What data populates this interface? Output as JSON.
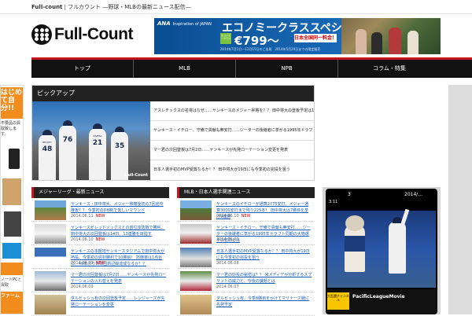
{
  "site": {
    "tagline_brand": "Full-count",
    "tagline_rest": " | フルカウント ―野球・MLBの最新ニュース配信―",
    "logo_text": "Full-Count"
  },
  "ad": {
    "ana_text": "ANA",
    "ana_sub": "Inspiration of JAPAN",
    "headline": "エコノミークラススペシャル",
    "tag_text": "エコノミークラス",
    "price": "€799～",
    "badge": "日本全国同一料金！",
    "fine": "2014年7月1日～12月15日のご出発　2014年5月20日までの限定販売"
  },
  "nav": {
    "items": [
      "トップ",
      "MLB",
      "NPB",
      "コラム・特集"
    ]
  },
  "pickup": {
    "title": "ピックアップ",
    "photo_watermark": "Full-Count",
    "players": [
      {
        "name": "BECKEY",
        "number": "48"
      },
      {
        "name": "",
        "number": "76"
      },
      {
        "name": "RIVERA",
        "number": "21"
      },
      {
        "name": "",
        "number": "35"
      }
    ],
    "links": [
      "アスレチックスの名将はなぜ……ヤンキースのメジャー昇格を？？ 田中将大の登板予定は14日、13連勝を目指す",
      "ヤンキース・イチロー、守備で貢献も無安打……ジーターの後継者に挙がる1995年ドラフト同期の大物選手の名前とは",
      "マー君の次回登板は7月2日……ヤンキースが先発ローテーション変更を発表",
      "日本人選手初のMVP受賞なるか！？ 田中将大が19日にも今季初の完投を狙う"
    ]
  },
  "list1": {
    "title": "メジャーリーグ・最新ニュース",
    "rows": [
      {
        "title": "ヤンキース・田中将大、メジャー移籍後初の7回途中降板？？ 今季初のDH制で苦しいマウンド",
        "date": "2014.06.11",
        "new": "NEW"
      },
      {
        "title": "ヤンキースがレッドソックスとの首位攻防戦で勝利、田中将大の次回登板は14日、13連勝を目指す",
        "date": "2014.06.10",
        "new": "NEW"
      },
      {
        "title": "ヤンキースの本拠地ヤンキースタジアムで田中将大が熱投、今季初の完封勝利で10勝目！ 防御率は1点台に、49年ぶりの球団新記録達成なるか！？",
        "date": "2014.06.09",
        "new": "NEW"
      },
      {
        "title": "マー君の次回登板は7月2日……ヤンキースが先発ローテーションの入れ替えを発表",
        "date": "2014.06.09",
        "new": ""
      },
      {
        "title": "ダルビッシュ有の次回登板予定……レンジャーズが先発ローテーションを変更",
        "date": "",
        "new": ""
      }
    ]
  },
  "list2": {
    "title": "MLB・日本人選手関連ニュース",
    "rows": [
      {
        "title": "ヤンキースのイチローが通算2775安打、メジャー通算3000安打まで残り225本！ 田中将大は7勝目を挙げ9連勝",
        "date": "2014.06.10",
        "new": "NEW"
      },
      {
        "title": "ヤンキース・イチロー、守備で貢献も無安打……ジーターの後継者に挙がる1995年ドラフト同期の大物選手の名前とは",
        "date": "2014.06.09",
        "new": ""
      },
      {
        "title": "日本人選手初のMVP受賞なるか！？ 田中将大が19日にも今季初の完投を狙う",
        "date": "2014.06.08",
        "new": ""
      },
      {
        "title": "マー君の好投の秘密は？？ 米メディアが分析するスプリットの威力と、今後の課題とは",
        "date": "2014.06.07",
        "new": ""
      },
      {
        "title": "ダルビッシュ有、今季8勝目をかけてマリナーズ戦に先発予定",
        "date": "",
        "new": ""
      }
    ]
  },
  "video": {
    "top_left": "3",
    "top_right": "2014/...",
    "time": "3:11",
    "chip": "大乱闘チャンネル",
    "channel": "PacificLeagueMovie"
  },
  "side_ad": {
    "headline": "はじめて自分!!",
    "copy": "不要品の買取致します。",
    "copy2": "ノートPCと買取",
    "bottom": "ファーム"
  }
}
